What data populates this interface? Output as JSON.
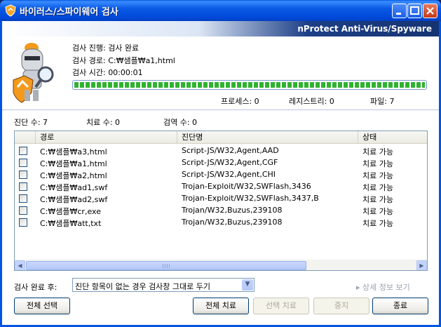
{
  "window": {
    "title": "바이러스/스파이웨어 검사",
    "brand": "nProtect Anti-Virus/Spyware"
  },
  "scan": {
    "status_label": "검사 진행:",
    "status_value": "검사 완료",
    "path_label": "검사 경로:",
    "path_value": "C:₩샘플₩a1,html",
    "time_label": "검사 시간:",
    "time_value": "00:00:01",
    "progress": 1.0
  },
  "stats": {
    "process": "프로세스: 0",
    "registry": "레지스트리: 0",
    "file": "파일: 7"
  },
  "summary": {
    "diagnosed": "진단 수: 7",
    "treated": "치료 수: 0",
    "quarantined": "검역 수: 0"
  },
  "table": {
    "columns": [
      "경로",
      "진단명",
      "상태"
    ],
    "rows": [
      {
        "path": "C:₩샘플₩a3,html",
        "name": "Script-JS/W32,Agent,AAD",
        "status": "치료 가능"
      },
      {
        "path": "C:₩샘플₩a1,html",
        "name": "Script-JS/W32,Agent,CGF",
        "status": "치료 가능"
      },
      {
        "path": "C:₩샘플₩a2,html",
        "name": "Script-JS/W32,Agent,CHI",
        "status": "치료 가능"
      },
      {
        "path": "C:₩샘플₩ad1,swf",
        "name": "Trojan-Exploit/W32,SWFlash,3436",
        "status": "치료 가능"
      },
      {
        "path": "C:₩샘플₩ad2,swf",
        "name": "Trojan-Exploit/W32,SWFlash,3437,B",
        "status": "치료 가능"
      },
      {
        "path": "C:₩샘플₩cr,exe",
        "name": "Trojan/W32,Buzus,239108",
        "status": "치료 가능"
      },
      {
        "path": "C:₩샘플₩att,txt",
        "name": "Trojan/W32,Buzus,239108",
        "status": "치료 가능"
      }
    ]
  },
  "after": {
    "label": "검사 완료 후:",
    "selected": "진단 항목이 없는 경우 검사창 그대로 두기"
  },
  "detail_link": "▸ 상세 정보 보기",
  "buttons": {
    "select_all": "전체 선택",
    "treat_all": "전체 치료",
    "treat_selected": "선택 치료",
    "stop": "중지",
    "close": "종료"
  },
  "colors": {
    "titlebar": "#0054e3",
    "progress": "#2fb32f",
    "brand_dark": "#163472"
  }
}
